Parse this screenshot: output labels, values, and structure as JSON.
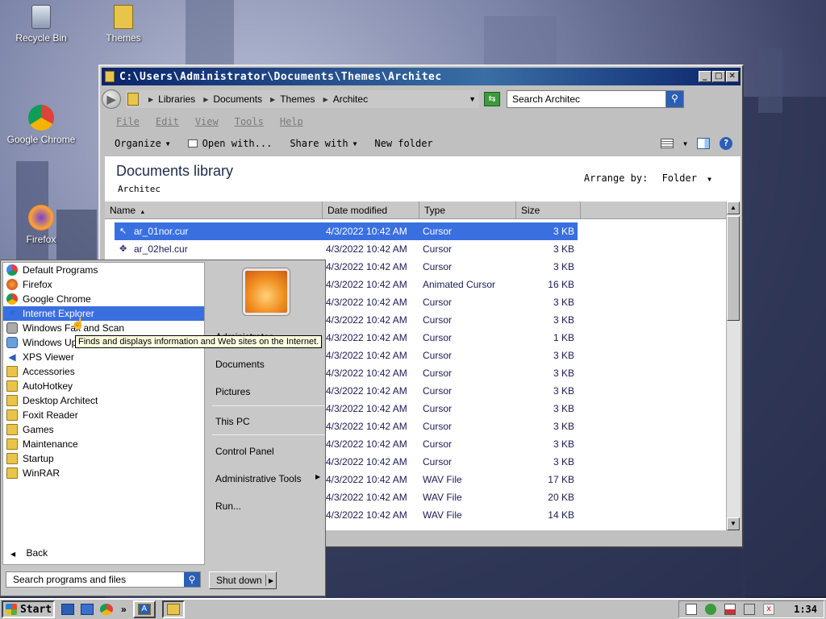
{
  "desktop": {
    "icons": [
      {
        "label": "Recycle Bin",
        "icon": "recycle-bin-icon"
      },
      {
        "label": "Themes",
        "icon": "folder-icon"
      },
      {
        "label": "Google Chrome",
        "icon": "chrome-icon"
      },
      {
        "label": "Firefox",
        "icon": "firefox-icon"
      }
    ]
  },
  "explorer": {
    "title": "C:\\Users\\Administrator\\Documents\\Themes\\Architec",
    "breadcrumbs": [
      "Libraries",
      "Documents",
      "Themes",
      "Architec"
    ],
    "search_placeholder": "Search Architec",
    "menu": [
      "File",
      "Edit",
      "View",
      "Tools",
      "Help"
    ],
    "commands": {
      "organize": "Organize",
      "open_with": "Open with...",
      "share_with": "Share with",
      "new_folder": "New folder"
    },
    "library_title": "Documents library",
    "library_subtitle": "Architec",
    "arrange_label": "Arrange by:",
    "arrange_value": "Folder",
    "columns": {
      "name": "Name",
      "date": "Date modified",
      "type": "Type",
      "size": "Size"
    },
    "rows": [
      {
        "name": "ar_01nor.cur",
        "date": "4/3/2022 10:42 AM",
        "type": "Cursor",
        "size": "3 KB"
      },
      {
        "name": "ar_02hel.cur",
        "date": "4/3/2022 10:42 AM",
        "type": "Cursor",
        "size": "3 KB"
      },
      {
        "name": "",
        "date": "4/3/2022 10:42 AM",
        "type": "Cursor",
        "size": "3 KB"
      },
      {
        "name": "",
        "date": "4/3/2022 10:42 AM",
        "type": "Animated Cursor",
        "size": "16 KB"
      },
      {
        "name": "",
        "date": "4/3/2022 10:42 AM",
        "type": "Cursor",
        "size": "3 KB"
      },
      {
        "name": "",
        "date": "4/3/2022 10:42 AM",
        "type": "Cursor",
        "size": "3 KB"
      },
      {
        "name": "",
        "date": "4/3/2022 10:42 AM",
        "type": "Cursor",
        "size": "1 KB"
      },
      {
        "name": "",
        "date": "4/3/2022 10:42 AM",
        "type": "Cursor",
        "size": "3 KB"
      },
      {
        "name": "",
        "date": "4/3/2022 10:42 AM",
        "type": "Cursor",
        "size": "3 KB"
      },
      {
        "name": "",
        "date": "4/3/2022 10:42 AM",
        "type": "Cursor",
        "size": "3 KB"
      },
      {
        "name": "",
        "date": "4/3/2022 10:42 AM",
        "type": "Cursor",
        "size": "3 KB"
      },
      {
        "name": "",
        "date": "4/3/2022 10:42 AM",
        "type": "Cursor",
        "size": "3 KB"
      },
      {
        "name": "",
        "date": "4/3/2022 10:42 AM",
        "type": "Cursor",
        "size": "3 KB"
      },
      {
        "name": "",
        "date": "4/3/2022 10:42 AM",
        "type": "Cursor",
        "size": "3 KB"
      },
      {
        "name": "",
        "date": "4/3/2022 10:42 AM",
        "type": "WAV File",
        "size": "17 KB"
      },
      {
        "name": "",
        "date": "4/3/2022 10:42 AM",
        "type": "WAV File",
        "size": "20 KB"
      },
      {
        "name": "",
        "date": "4/3/2022 10:42 AM",
        "type": "WAV File",
        "size": "14 KB"
      }
    ]
  },
  "start_menu": {
    "programs": [
      {
        "label": "Default Programs",
        "icon": "default-programs-icon"
      },
      {
        "label": "Firefox",
        "icon": "firefox-icon"
      },
      {
        "label": "Google Chrome",
        "icon": "chrome-icon"
      },
      {
        "label": "Internet Explorer",
        "icon": "internet-explorer-icon"
      },
      {
        "label": "Windows Fax and Scan",
        "icon": "fax-scan-icon"
      },
      {
        "label": "Windows Update",
        "icon": "windows-update-icon"
      },
      {
        "label": "XPS Viewer",
        "icon": "xps-viewer-icon"
      },
      {
        "label": "Accessories",
        "icon": "folder-icon"
      },
      {
        "label": "AutoHotkey",
        "icon": "folder-icon"
      },
      {
        "label": "Desktop Architect",
        "icon": "folder-icon"
      },
      {
        "label": "Foxit Reader",
        "icon": "folder-icon"
      },
      {
        "label": "Games",
        "icon": "folder-icon"
      },
      {
        "label": "Maintenance",
        "icon": "folder-icon"
      },
      {
        "label": "Startup",
        "icon": "folder-icon"
      },
      {
        "label": "WinRAR",
        "icon": "folder-icon"
      }
    ],
    "back_label": "Back",
    "search_placeholder": "Search programs and files",
    "right_links": {
      "user": "Administrator",
      "documents": "Documents",
      "pictures": "Pictures",
      "this_pc": "This PC",
      "control_panel": "Control Panel",
      "admin_tools": "Administrative Tools",
      "run": "Run..."
    },
    "shutdown_label": "Shut down",
    "tooltip": "Finds and displays information and Web sites on the Internet."
  },
  "taskbar": {
    "start_label": "Start",
    "more_label": "»",
    "clock": "1:34"
  },
  "colors": {
    "selection": "#3a6fe0",
    "titlebar": "#0a246a",
    "tooltip_bg": "#ffffe1"
  }
}
